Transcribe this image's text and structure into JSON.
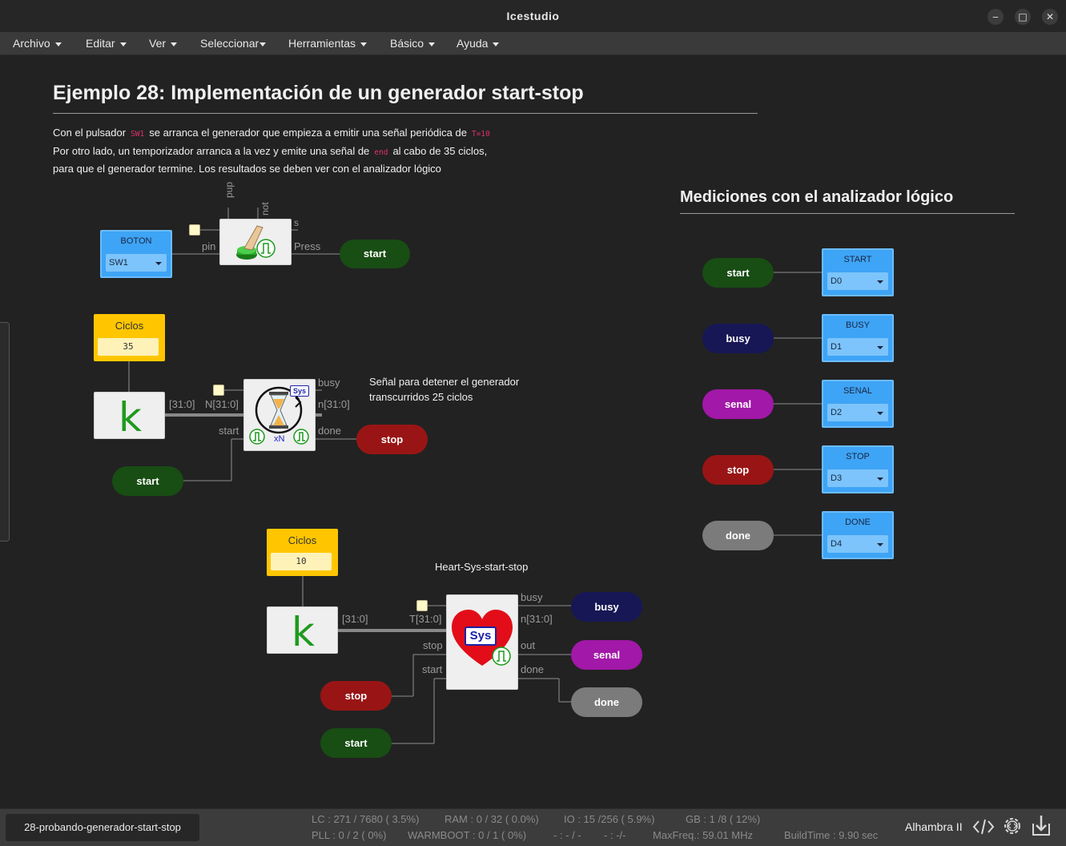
{
  "window": {
    "title": "Icestudio",
    "minimize": "‒",
    "maximize": "□",
    "close": "✕"
  },
  "menu": [
    "Archivo",
    "Editar",
    "Ver",
    "Seleccionar",
    "Herramientas",
    "Básico",
    "Ayuda"
  ],
  "doc": {
    "title": "Ejemplo 28: Implementación de un generador start-stop",
    "line1_a": "Con el pulsador",
    "line1_code1": "SW1",
    "line1_b": "se arranca el generador que empieza a emitir una señal periódica de",
    "line1_code2": "T=10",
    "line2_a": "Por otro lado, un temporizador arranca a la vez y emite una señal de",
    "line2_code": "end",
    "line2_b": "al cabo de 35 ciclos,",
    "line3": "para que el generador termine. Los resultados se deben ver con el analizador lógico",
    "right_title": "Mediciones con el analizador lógico",
    "note1_l1": "Señal para detener el generador",
    "note1_l2": "transcurridos 25 ciclos",
    "heart_label": "Heart-Sys-start-stop"
  },
  "blocks": {
    "boton": {
      "label": "BOTON",
      "value": "SW1"
    },
    "button_ports": {
      "pup": "pup",
      "not": "not",
      "s": "s",
      "pin": "pin",
      "press": "Press"
    },
    "ciclos1": {
      "label": "Ciclos",
      "value": "35"
    },
    "ciclos2": {
      "label": "Ciclos",
      "value": "10"
    },
    "k": "k",
    "timer_ports": {
      "in": "[31:0]",
      "N": "N[31:0]",
      "busy": "busy",
      "n": "n[31:0]",
      "start": "start",
      "done": "done",
      "sys": "Sys",
      "xN": "xN"
    },
    "heart_ports": {
      "in": "[31:0]",
      "T": "T[31:0]",
      "busy": "busy",
      "n": "n[31:0]",
      "stop": "stop",
      "out": "out",
      "start": "start",
      "done": "done",
      "sys": "Sys"
    },
    "pills": {
      "start1": "start",
      "start2": "start",
      "start3": "start",
      "stop1": "stop",
      "stop2": "stop",
      "busy": "busy",
      "senal": "senal",
      "done": "done"
    },
    "analyzer": [
      {
        "pill": "start",
        "label": "START",
        "value": "D0"
      },
      {
        "pill": "busy",
        "label": "BUSY",
        "value": "D1"
      },
      {
        "pill": "senal",
        "label": "SENAL",
        "value": "D2"
      },
      {
        "pill": "stop",
        "label": "STOP",
        "value": "D3"
      },
      {
        "pill": "done",
        "label": "DONE",
        "value": "D4"
      }
    ]
  },
  "status": {
    "tab": "28-probando-generador-start-stop",
    "lc": "LC : 271 / 7680 ( 3.5%)",
    "ram": "RAM : 0 / 32 ( 0.0%)",
    "io": "IO :  15 /256  ( 5.9%)",
    "gb": "GB :  1 /8  ( 12%)",
    "pll": "PLL : 0 / 2 ( 0%)",
    "warmboot": "WARMBOOT : 0 / 1 ( 0%)",
    "dash1": "- : - / -",
    "dash2": "- :  -/-",
    "maxfreq": "MaxFreq.:  59.01 MHz",
    "buildtime": "BuildTime :  9.90 sec",
    "board": "Alhambra II"
  }
}
